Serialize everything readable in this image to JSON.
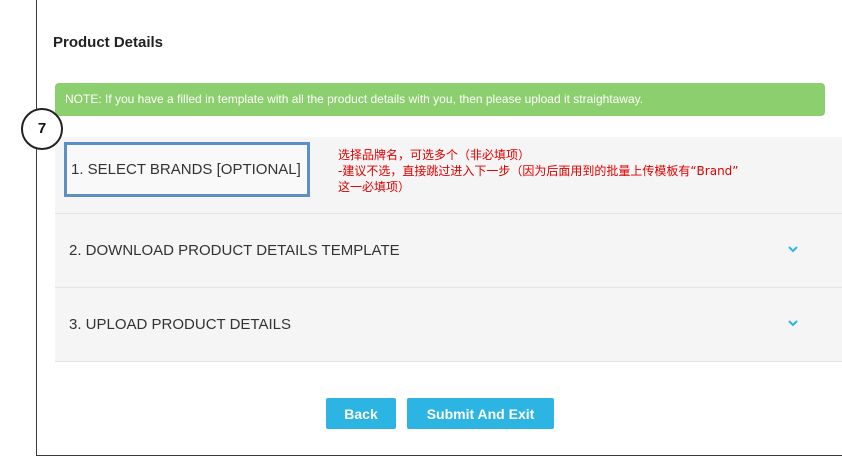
{
  "panel": {
    "title": "Product Details",
    "note": "NOTE: If you have a filled in template with all the product details with you, then please upload it straightaway."
  },
  "step_marker": "7",
  "accordion": [
    {
      "label": "1. SELECT BRANDS [OPTIONAL]"
    },
    {
      "label": "2. DOWNLOAD PRODUCT DETAILS TEMPLATE"
    },
    {
      "label": "3. UPLOAD PRODUCT DETAILS"
    }
  ],
  "annotation": {
    "line1": "选择品牌名，可选多个（非必填项）",
    "line2": "-建议不选，直接跳过进入下一步（因为后面用到的批量上传模板有“Brand”",
    "line3": "这一必填项）"
  },
  "buttons": {
    "back": "Back",
    "submit": "Submit And Exit"
  },
  "colors": {
    "note_bg": "#8ccf6e",
    "button_bg": "#2cb4e3",
    "highlight_border": "#5b8fc5",
    "annotation_text": "#e00000",
    "chevron": "#2cb4e3"
  },
  "icons": {
    "chevron": "chevron-down-icon"
  }
}
